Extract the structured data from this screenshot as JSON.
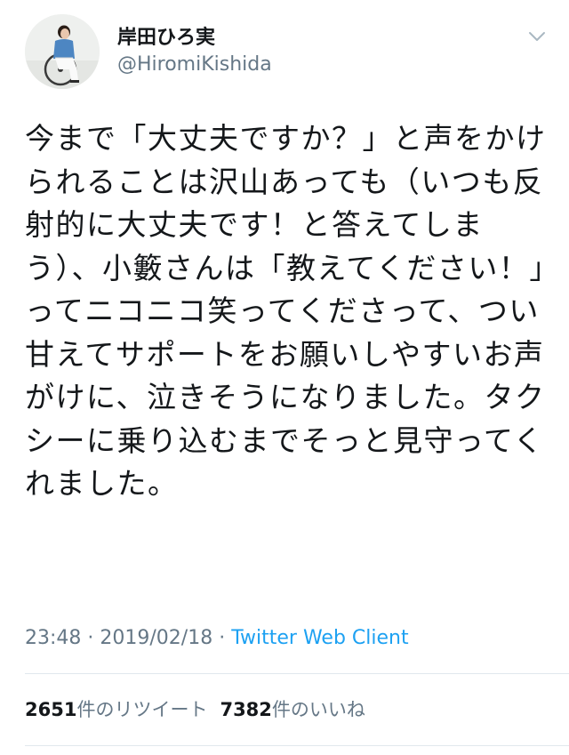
{
  "author": {
    "display_name": "岸田ひろ実",
    "handle": "@HiromiKishida",
    "avatar_icon": "profile-photo-icon",
    "menu_icon": "chevron-down-icon"
  },
  "tweet": {
    "text": "今まで「大丈夫ですか？」と声をかけられることは沢山あっても（いつも反射的に大丈夫です！と答えてしまう）、小籔さんは「教えてください！」ってニコニコ笑ってくださって、つい甘えてサポートをお願いしやすいお声がけに、泣きそうになりました。タクシーに乗り込むまでそっと見守ってくれました。"
  },
  "meta": {
    "time": "23:48",
    "separator": "·",
    "date": "2019/02/18",
    "source": "Twitter Web Client"
  },
  "stats": {
    "retweets_count": "2651",
    "retweets_label": "件のリツイート",
    "likes_count": "7382",
    "likes_label": "件のいいね"
  },
  "colors": {
    "text": "#14171a",
    "secondary": "#657786",
    "link": "#1da1f2",
    "divider": "#e1e8ed"
  }
}
